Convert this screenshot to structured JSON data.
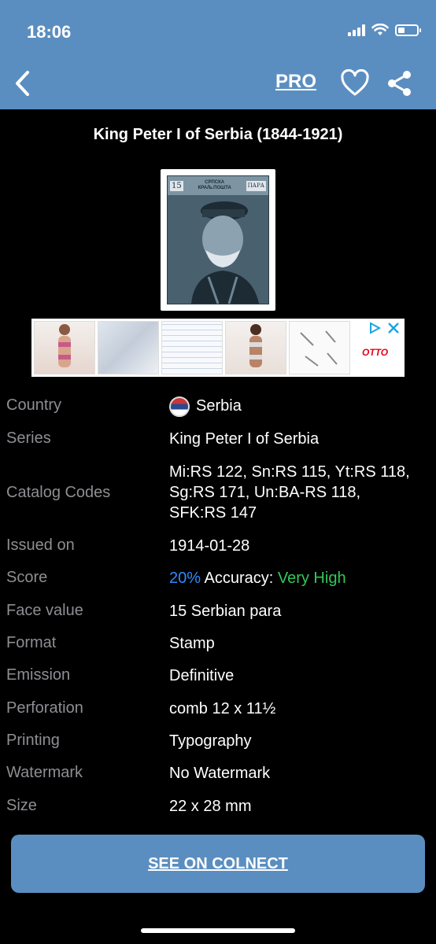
{
  "status": {
    "time": "18:06",
    "battery_level": 0.35
  },
  "nav": {
    "pro_label": "PRO"
  },
  "title": "King Peter I of Serbia (1844-1921)",
  "stamp": {
    "value_text": "15",
    "top_text_1": "СРПСКА",
    "top_text_2": "КРАЉ.ПОШТА",
    "currency_text": "ПАРА"
  },
  "ad": {
    "brand": "OTTO"
  },
  "details": [
    {
      "label": "Country",
      "value": "Serbia"
    },
    {
      "label": "Series",
      "value": "King Peter I of Serbia"
    },
    {
      "label": "Catalog Codes",
      "value_lines": [
        "Mi:RS 122, Sn:RS 115, Yt:RS 118,",
        "Sg:RS 171, Un:BA-RS 118,",
        "SFK:RS 147"
      ]
    },
    {
      "label": "Issued on",
      "value": "1914-01-28"
    },
    {
      "label": "Score",
      "score": "20%",
      "accuracy_label": "Accuracy:",
      "accuracy_value": "Very High"
    },
    {
      "label": "Face value",
      "value": "15 Serbian para"
    },
    {
      "label": "Format",
      "value": "Stamp"
    },
    {
      "label": "Emission",
      "value": "Definitive"
    },
    {
      "label": "Perforation",
      "value": "comb 12 x 11½"
    },
    {
      "label": "Printing",
      "value": "Typography"
    },
    {
      "label": "Watermark",
      "value": "No Watermark"
    },
    {
      "label": "Size",
      "value": "22 x 28 mm"
    }
  ],
  "cta": {
    "label": "SEE ON COLNECT"
  },
  "colors": {
    "header": "#5b8ec0",
    "accent_blue": "#2f8bff",
    "accent_green": "#34c759",
    "label_gray": "#8e8e93"
  }
}
